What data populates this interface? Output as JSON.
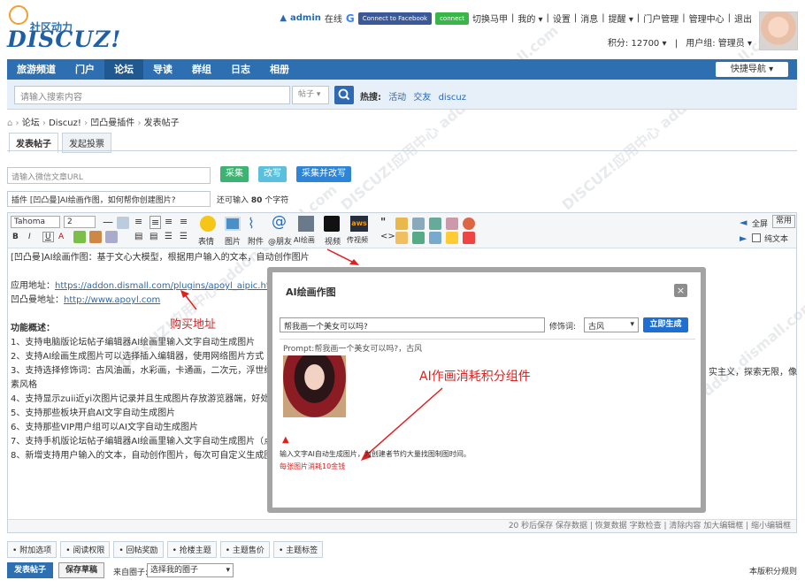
{
  "header": {
    "logo_cn": "社区动力",
    "logo_en": "DISCUZ!",
    "username": "admin",
    "online": "在线",
    "google": "G",
    "facebook_btn": "Connect to Facebook",
    "wechat_btn": "connect",
    "links": [
      "切换马甲",
      "我的 ▾",
      "设置",
      "消息",
      "提醒 ▾",
      "门户管理",
      "管理中心",
      "退出"
    ],
    "credits": "积分: 12700 ▾",
    "usergroup": "用户组: 管理员 ▾"
  },
  "nav": {
    "items": [
      "旅游频道",
      "门户",
      "论坛",
      "导读",
      "群组",
      "日志",
      "相册"
    ],
    "active_index": 2,
    "quick": "快捷导航 ▾"
  },
  "search": {
    "placeholder": "请输入搜索内容",
    "scope": "帖子 ▾",
    "hot_label": "热搜:",
    "hot_words": [
      "活动",
      "交友",
      "discuz"
    ]
  },
  "breadcrumb": [
    "论坛",
    "Discuz!",
    "凹凸曼插件",
    "发表帖子"
  ],
  "tabs": [
    "发表帖子",
    "发起投票"
  ],
  "form": {
    "url_placeholder": "请输入微信文章URL",
    "btn_collect": "采集",
    "btn_rewrite": "改写",
    "btn_collect_rewrite": "采集并改写",
    "title_value": "插件 [凹凸曼]AI绘画作图，如何帮你创建图片?",
    "limit_prefix": "还可输入",
    "limit_num": "80",
    "limit_suffix": "个字符"
  },
  "toolbar": {
    "font": "Tahoma",
    "size": "2",
    "labels": [
      "表情",
      "图片",
      "附件",
      "@朋友",
      "AI绘画",
      "视频",
      "传视频"
    ],
    "fullscreen": "全屏",
    "common": "常用",
    "plaintext": "纯文本"
  },
  "content": {
    "line1": "[凹凸曼]AI绘画作图：基于文心大模型，根据用户输入的文本，自动创作图片",
    "app_label": "应用地址：",
    "app_url": "https://addon.dismall.com/plugins/apoyl_aipic.html",
    "site_label": "凹凸曼地址：",
    "site_url": "http://www.apoyl.com",
    "buy_annotation": "购买地址",
    "feature_title": "功能概述：",
    "features": [
      "1、支持电脑版论坛帖子编辑器AI绘画里输入文字自动生成图片",
      "2、支持AI绘画生成图片可以选择插入编辑器，使用网络图片方式",
      "3、支持选择修饰词：古风油画，水彩画，卡通画，二次元，浮世绘，",
      "素风格",
      "4、支持显示zuii近yi次图片记录并且生成图片存放游览器端，好处不会",
      "5、支持那些板块开启AI文字自动生成图片",
      "6、支持那些VIP用户组可以AI文字自动生成图片",
      "7、支持手机版论坛帖子编辑器AI绘画里输入文字自动生成图片（点击",
      "8、新增支持用户输入的文本，自动创作图片，每次可自定义生成图片"
    ],
    "feature3_tail": "实主义，探索无限，像"
  },
  "dialog": {
    "title": "AI绘画作图",
    "close": "×",
    "input_value": "帮我画一个美女可以吗?",
    "modifier_label": "修饰词:",
    "modifier_value": "古风",
    "generate_btn": "立即生成",
    "prompt_text": "Prompt:帮我画一个美女可以吗?，古风",
    "annotation": "AI作画消耗积分组件",
    "desc": "输入文字AI自动生成图片，为创建者节约大量找图制图时间。",
    "cost": "每张图片消耗10金钱"
  },
  "status": {
    "text": "20 秒后保存 保存数据 | 恢复数据    字数检查 | 清除内容    加大编辑框 | 缩小编辑框"
  },
  "options": [
    "附加选项",
    "阅读权限",
    "回帖奖励",
    "抢楼主题",
    "主题售价",
    "主题标签"
  ],
  "footer": {
    "submit": "发表帖子",
    "draft": "保存草稿",
    "circle_label": "来自圈子:",
    "circle_value": "选择我的圈子",
    "rules": "本版积分规则"
  },
  "watermark": "DISCUZ!应用中心 addon.dismall.com",
  "colors": {
    "nav": "#2d6fb0",
    "collect": "#3cb371",
    "rewrite": "#5bc0de",
    "collect_rewrite": "#2e84d6",
    "accent_red": "#e02020"
  }
}
